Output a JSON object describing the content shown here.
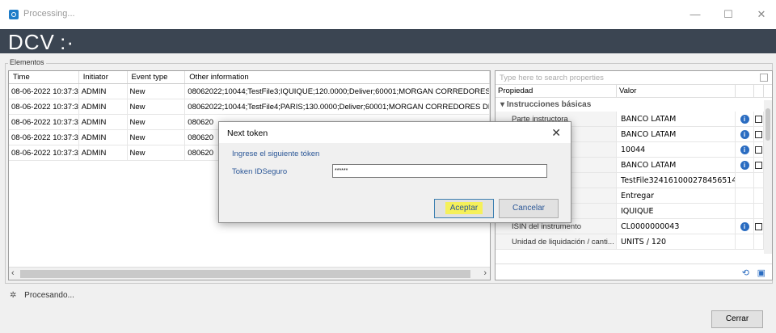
{
  "window": {
    "title": "Processing...",
    "minimize": "—",
    "maximize": "☐",
    "close": "✕"
  },
  "banner": {
    "logo": "DCV :·"
  },
  "group_label": "Elementos",
  "grid": {
    "columns": [
      "Time",
      "Initiator",
      "Event type",
      "Other information"
    ],
    "rows": [
      [
        "08-06-2022 10:37:34",
        "ADMIN",
        "New",
        "08062022;10044;TestFile3;IQUIQUE;120.0000;Deliver;60001;MORGAN CORREDORES"
      ],
      [
        "08-06-2022 10:37:35",
        "ADMIN",
        "New",
        "08062022;10044;TestFile4;PARIS;130.0000;Deliver;60001;MORGAN CORREDORES DE"
      ],
      [
        "08-06-2022 10:37:35",
        "ADMIN",
        "New",
        "080620"
      ],
      [
        "08-06-2022 10:37:34",
        "ADMIN",
        "New",
        "080620"
      ],
      [
        "08-06-2022 10:37:34",
        "ADMIN",
        "New",
        "080620"
      ]
    ]
  },
  "props": {
    "search_placeholder": "Type here to search properties",
    "col_property": "Propiedad",
    "col_value": "Valor",
    "section": "Instrucciones básicas",
    "rows": [
      {
        "key": "Parte instructora",
        "value": "BANCO LATAM",
        "info": true,
        "link": true
      },
      {
        "key": "",
        "value": "BANCO LATAM",
        "info": true,
        "link": true
      },
      {
        "key": "s",
        "value": "10044",
        "info": true,
        "link": true
      },
      {
        "key": "",
        "value": "BANCO LATAM",
        "info": true,
        "link": true
      },
      {
        "key": "trucción",
        "value": "TestFile324161000278456514",
        "info": false,
        "link": false
      },
      {
        "key": "lores",
        "value": "Entregar",
        "info": false,
        "link": false
      },
      {
        "key": "mento",
        "value": "IQUIQUE",
        "info": false,
        "link": false
      },
      {
        "key": "ISIN del instrumento",
        "value": "CL0000000043",
        "info": true,
        "link": true
      },
      {
        "key": "Unidad de liquidación / canti...",
        "value": "UNITS / 120",
        "info": false,
        "link": false
      }
    ]
  },
  "status": "Procesando...",
  "close_button": "Cerrar",
  "dialog": {
    "title": "Next token",
    "prompt": "Ingrese el siguiente tóken",
    "field_label": "Token IDSeguro",
    "field_value": "******",
    "accept": "Aceptar",
    "cancel": "Cancelar"
  }
}
